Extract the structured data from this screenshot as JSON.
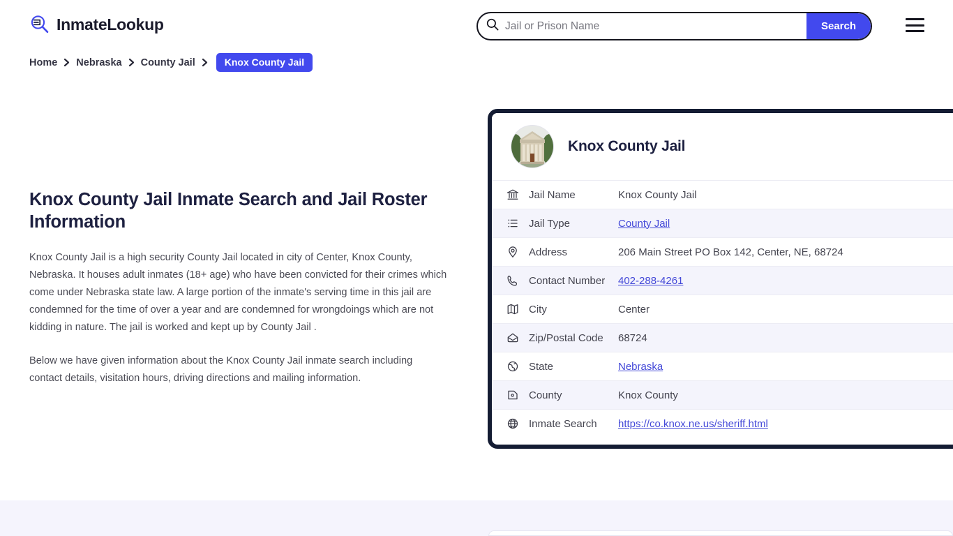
{
  "header": {
    "brand": "InmateLookup",
    "logo_icon": "magnifier-list-icon",
    "menu_icon": "hamburger-menu-icon",
    "accent_color": "#4249ee",
    "dark_color": "#141c33"
  },
  "search": {
    "icon": "search-icon",
    "value": "",
    "placeholder": "Jail or Prison Name",
    "button_label": "Search"
  },
  "breadcrumb": {
    "items": [
      {
        "label": "Home",
        "current": false
      },
      {
        "label": "Nebraska",
        "current": false
      },
      {
        "label": "County Jail",
        "current": false
      },
      {
        "label": "Knox County Jail",
        "current": true
      }
    ]
  },
  "main": {
    "headline": "Knox County Jail Inmate Search and Jail Roster Information",
    "paragraph1": "Knox County Jail is a high security County Jail located in city of Center, Knox County, Nebraska. It houses adult inmates (18+ age) who have been convicted for their crimes which come under Nebraska state law. A large portion of the inmate's serving time in this jail are condemned for the time of over a year and are condemned for wrongdoings which are not kidding in nature. The jail is worked and kept up by County Jail .",
    "paragraph2": "Below we have given information about the Knox County Jail inmate search including contact details, visitation hours, driving directions and mailing information."
  },
  "info_card": {
    "avatar_icon": "courthouse-photo",
    "title": "Knox County Jail",
    "rows": [
      {
        "icon": "bank-icon",
        "label": "Jail Name",
        "value": "Knox County Jail",
        "link": false
      },
      {
        "icon": "list-icon",
        "label": "Jail Type",
        "value": "County Jail",
        "link": true
      },
      {
        "icon": "map-pin-icon",
        "label": "Address",
        "value": "206 Main Street PO Box 142, Center, NE, 68724",
        "link": false
      },
      {
        "icon": "phone-icon",
        "label": "Contact Number",
        "value": "402-288-4261",
        "link": true
      },
      {
        "icon": "map-icon",
        "label": "City",
        "value": "Center",
        "link": false
      },
      {
        "icon": "envelope-icon",
        "label": "Zip/Postal Code",
        "value": "68724",
        "link": false
      },
      {
        "icon": "globe-pin-icon",
        "label": "State",
        "value": "Nebraska",
        "link": true
      },
      {
        "icon": "county-map-icon",
        "label": "County",
        "value": "Knox County",
        "link": false
      },
      {
        "icon": "globe-icon",
        "label": "Inmate Search",
        "value": "https://co.knox.ne.us/sheriff.html",
        "link": true
      }
    ]
  }
}
